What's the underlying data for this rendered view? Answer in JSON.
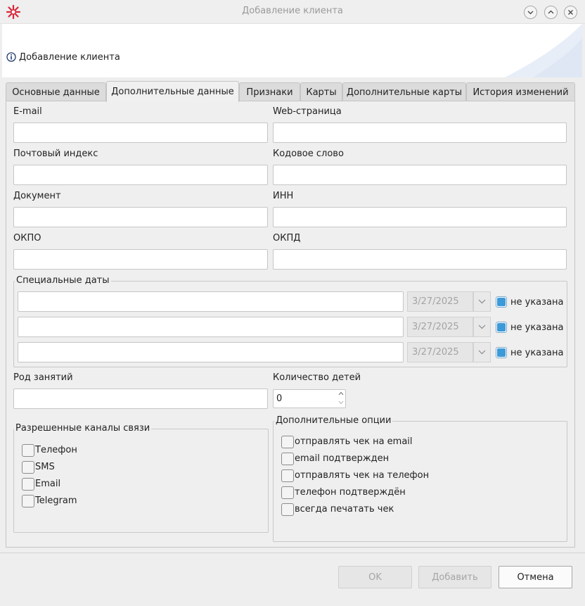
{
  "window": {
    "title": "Добавление клиента",
    "icons": [
      "app-logo-icon",
      "minimize-icon",
      "maximize-icon",
      "close-icon"
    ]
  },
  "header": {
    "title": "Добавление клиента",
    "icon": "info-icon"
  },
  "tabs": [
    {
      "label": "Основные данные",
      "active": false
    },
    {
      "label": "Дополнительные данные",
      "active": true
    },
    {
      "label": "Признаки",
      "active": false
    },
    {
      "label": "Карты",
      "active": false
    },
    {
      "label": "Дополнительные карты",
      "active": false
    },
    {
      "label": "История изменений",
      "active": false
    }
  ],
  "fields": {
    "email": {
      "label": "E-mail",
      "value": ""
    },
    "web": {
      "label": "Web-страница",
      "value": ""
    },
    "postal": {
      "label": "Почтовый индекс",
      "value": ""
    },
    "codeword": {
      "label": "Кодовое слово",
      "value": ""
    },
    "document": {
      "label": "Документ",
      "value": ""
    },
    "inn": {
      "label": "ИНН",
      "value": ""
    },
    "okpo": {
      "label": "ОКПО",
      "value": ""
    },
    "okpd": {
      "label": "ОКПД",
      "value": ""
    }
  },
  "special_dates": {
    "legend": "Специальные даты",
    "rows": [
      {
        "name": "",
        "date": "3/27/2025",
        "not_set_label": "не указана",
        "not_set": true
      },
      {
        "name": "",
        "date": "3/27/2025",
        "not_set_label": "не указана",
        "not_set": true
      },
      {
        "name": "",
        "date": "3/27/2025",
        "not_set_label": "не указана",
        "not_set": true
      }
    ]
  },
  "occupation": {
    "label": "Род занятий",
    "value": ""
  },
  "children": {
    "label": "Количество детей",
    "value": "0"
  },
  "channels": {
    "legend": "Разрешенные каналы связи",
    "items": [
      {
        "label": "Телефон",
        "checked": false
      },
      {
        "label": "SMS",
        "checked": false
      },
      {
        "label": "Email",
        "checked": false
      },
      {
        "label": "Telegram",
        "checked": false
      }
    ]
  },
  "options": {
    "legend": "Дополнительные опции",
    "items": [
      {
        "label": "отправлять чек на email",
        "checked": false
      },
      {
        "label": "email подтвержден",
        "checked": false
      },
      {
        "label": "отправлять чек на телефон",
        "checked": false
      },
      {
        "label": "телефон подтверждён",
        "checked": false
      },
      {
        "label": "всегда печатать чек",
        "checked": false
      }
    ]
  },
  "buttons": {
    "ok": {
      "label": "OK",
      "enabled": false
    },
    "add": {
      "label": "Добавить",
      "enabled": false
    },
    "cancel": {
      "label": "Отмена",
      "enabled": true
    }
  },
  "colors": {
    "accent": "#3d9ad9",
    "logo": "#d8283a"
  }
}
